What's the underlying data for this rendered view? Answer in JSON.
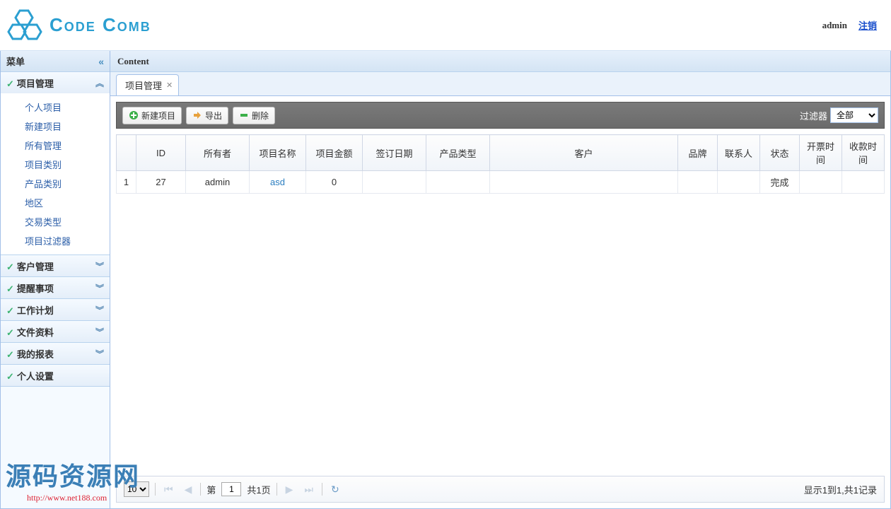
{
  "header": {
    "logo_text": "Code Comb",
    "user": "admin",
    "logout": "注销"
  },
  "sidebar": {
    "title": "菜单",
    "sections": [
      {
        "label": "项目管理",
        "expanded": true,
        "items": [
          "个人项目",
          "新建项目",
          "所有管理",
          "项目类别",
          "产品类别",
          "地区",
          "交易类型",
          "项目过滤器"
        ]
      },
      {
        "label": "客户管理",
        "expanded": false
      },
      {
        "label": "提醒事项",
        "expanded": false
      },
      {
        "label": "工作计划",
        "expanded": false
      },
      {
        "label": "文件资料",
        "expanded": false
      },
      {
        "label": "我的报表",
        "expanded": false
      },
      {
        "label": "个人设置",
        "expanded": false
      }
    ]
  },
  "content": {
    "header": "Content",
    "tab": "项目管理"
  },
  "toolbar": {
    "new_project": "新建项目",
    "export": "导出",
    "delete": "删除",
    "filter_label": "过滤器",
    "filter_value": "全部"
  },
  "grid": {
    "columns": [
      "",
      "ID",
      "所有者",
      "项目名称",
      "项目金额",
      "签订日期",
      "产品类型",
      "客户",
      "品牌",
      "联系人",
      "状态",
      "开票时间",
      "收款时间"
    ],
    "rows": [
      {
        "idx": "1",
        "id": "27",
        "owner": "admin",
        "name": "asd",
        "amount": "0",
        "sign_date": "",
        "prod_type": "",
        "customer": "",
        "brand": "",
        "contact": "",
        "status": "完成",
        "invoice_time": "",
        "pay_time": ""
      }
    ]
  },
  "pager": {
    "page_size": "10",
    "page_prefix": "第",
    "page": "1",
    "pages_label": "共1页",
    "info": "显示1到1,共1记录"
  },
  "watermark": {
    "main": "源码资源网",
    "url": "http://www.net188.com"
  }
}
